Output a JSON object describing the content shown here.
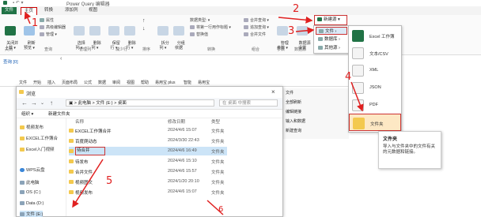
{
  "pq": {
    "title": "Power Query 编辑器",
    "tabs": [
      "文件",
      "主页",
      "转换",
      "添加列",
      "视图"
    ],
    "ribbon": {
      "close_apply": "关闭并\n上载 ▾",
      "close_group": "关闭",
      "refresh": "刷新\n预览 ▾",
      "properties": "属性",
      "advanced_editor": "高级编辑器",
      "manage": "管理 ▾",
      "query_group": "查询",
      "choose_cols": "选择\n列 ▾",
      "remove_cols": "删除\n列 ▾",
      "manage_cols_group": "管理列",
      "keep_rows": "保留\n行 ▾",
      "remove_rows": "删除\n行 ▾",
      "reduce_rows_group": "减少行",
      "sort_group": "排序",
      "split_col": "拆分\n列 ▾",
      "group_by": "分组\n依据",
      "data_type": "数据类型: ▾",
      "first_row_header": "将第一行用作标题 ▾",
      "replace_values": "替换值",
      "transform_group": "转换",
      "merge_queries": "合并查询 ▾",
      "append_queries": "追加查询 ▾",
      "combine_files": "合并文件",
      "combine_group": "组合",
      "manage_params": "管理\n参数 ▾",
      "params_group": "参数",
      "data_source_settings": "数据源\n设置",
      "data_source_group": "数据源",
      "new_source": "新建源 ▾"
    },
    "query_pane_label": "查询 [0]",
    "left_chevron": "‹"
  },
  "menu_main": {
    "items": [
      "文件",
      "数据库",
      "其他源"
    ]
  },
  "menu_sub": {
    "items": [
      "Excel 工作簿",
      "文本/CSV",
      "XML",
      "JSON",
      "PDF",
      "文件夹"
    ]
  },
  "tooltip": {
    "title": "文件夹",
    "desc": "导入与文件夹中的文件有关的元数据和链接。"
  },
  "excel": {
    "tabs": [
      "文件",
      "开始",
      "插入",
      "页面布局",
      "公式",
      "数据",
      "审阅",
      "视图",
      "帮助",
      "易用宝 plus",
      "智能",
      "易用宝"
    ],
    "right_pane": [
      "文件",
      "全部刷新",
      "编辑链接",
      "输入和数据",
      "新建查询"
    ]
  },
  "dialog": {
    "title": "浏览",
    "address": "▣  > 此电脑 > 文件 (E:) > 桌面",
    "search_placeholder": "在 桌面 中搜索",
    "cmd": [
      "组织 ▾",
      "新建文件夹"
    ],
    "headers": [
      "名称",
      "修改日期",
      "类型"
    ],
    "side": [
      "视频发布",
      "EXCEL工作簿合",
      "Excel入门视频",
      "WPS云盘",
      "此电脑",
      "OS (C:)",
      "Data (D:)",
      "文件 (E:)"
    ],
    "rows": [
      {
        "name": "EXCEL工作簿合并",
        "date": "2024/4/6 15:07",
        "type": "文件夹"
      },
      {
        "name": "百度爬动态",
        "date": "2024/3/30 22:43",
        "type": "文件夹"
      },
      {
        "name": "待合并",
        "date": "2024/4/6 16:49",
        "type": "文件夹"
      },
      {
        "name": "待发布",
        "date": "2024/4/6 15:10",
        "type": "文件夹"
      },
      {
        "name": "合并文件",
        "date": "2024/4/6 15:57",
        "type": "文件夹"
      },
      {
        "name": "视频图文",
        "date": "2024/1/20 20:10",
        "type": "文件夹"
      },
      {
        "name": "视频发布",
        "date": "2024/4/6 15:07",
        "type": "文件夹"
      }
    ]
  },
  "steps": [
    "1",
    "2",
    "3",
    "4",
    "5",
    "6"
  ],
  "colors": {
    "annotation": "#e02020",
    "excel_green": "#217346",
    "selection": "#cce4f7",
    "folder": "#f3c94e"
  }
}
